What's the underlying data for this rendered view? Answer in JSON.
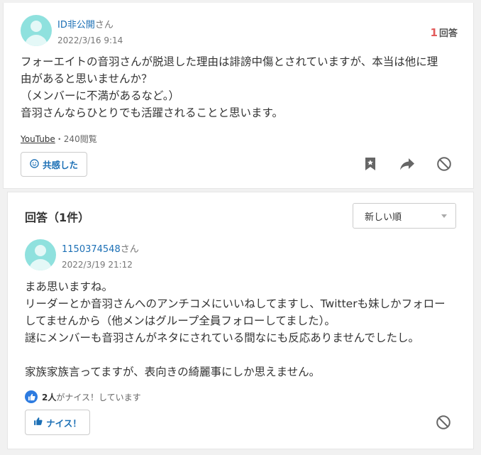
{
  "question": {
    "user": {
      "name": "ID非公開",
      "suffix": "さん"
    },
    "date": "2022/3/16 9:14",
    "answer_count": "1",
    "answer_count_label": "回答",
    "body": [
      "フォーエイトの音羽さんが脱退した理由は誹謗中傷とされていますが、本当は他に理",
      "由があると思いませんか？",
      "（メンバーに不満があるなど。）",
      "音羽さんならひとりでも活躍されることと思います。"
    ],
    "category": "YouTube",
    "views": "・240閲覧",
    "empathy_label": "共感した"
  },
  "answers": {
    "title": "回答（1件）",
    "sort": {
      "selected": "新しい順"
    },
    "item": {
      "user": {
        "name": "1150374548",
        "suffix": "さん"
      },
      "date": "2022/3/19 21:12",
      "body": [
        "まあ思いますね。",
        "リーダーとか音羽さんへのアンチコメにいいねしてますし、Twitterも妹しかフォロー",
        "してませんから（他メンはグループ全員フォローしてました）。",
        "謎にメンバーも音羽さんがネタにされている間なにも反応ありませんでしたし。",
        "",
        "家族家族言ってますが、表向きの綺麗事にしか思えません。"
      ],
      "nice_count": "2人",
      "nice_text": "がナイス！しています",
      "nice_button": "ナイス！"
    }
  },
  "colors": {
    "accent": "#1b6fb5",
    "count_red": "#e25a5a",
    "avatar": "#8fe1de",
    "nice_blue": "#2d7be0"
  },
  "icons": [
    "user-avatar-icon",
    "smile-icon",
    "bookmark-icon",
    "share-icon",
    "block-icon",
    "thumbs-up-icon"
  ]
}
